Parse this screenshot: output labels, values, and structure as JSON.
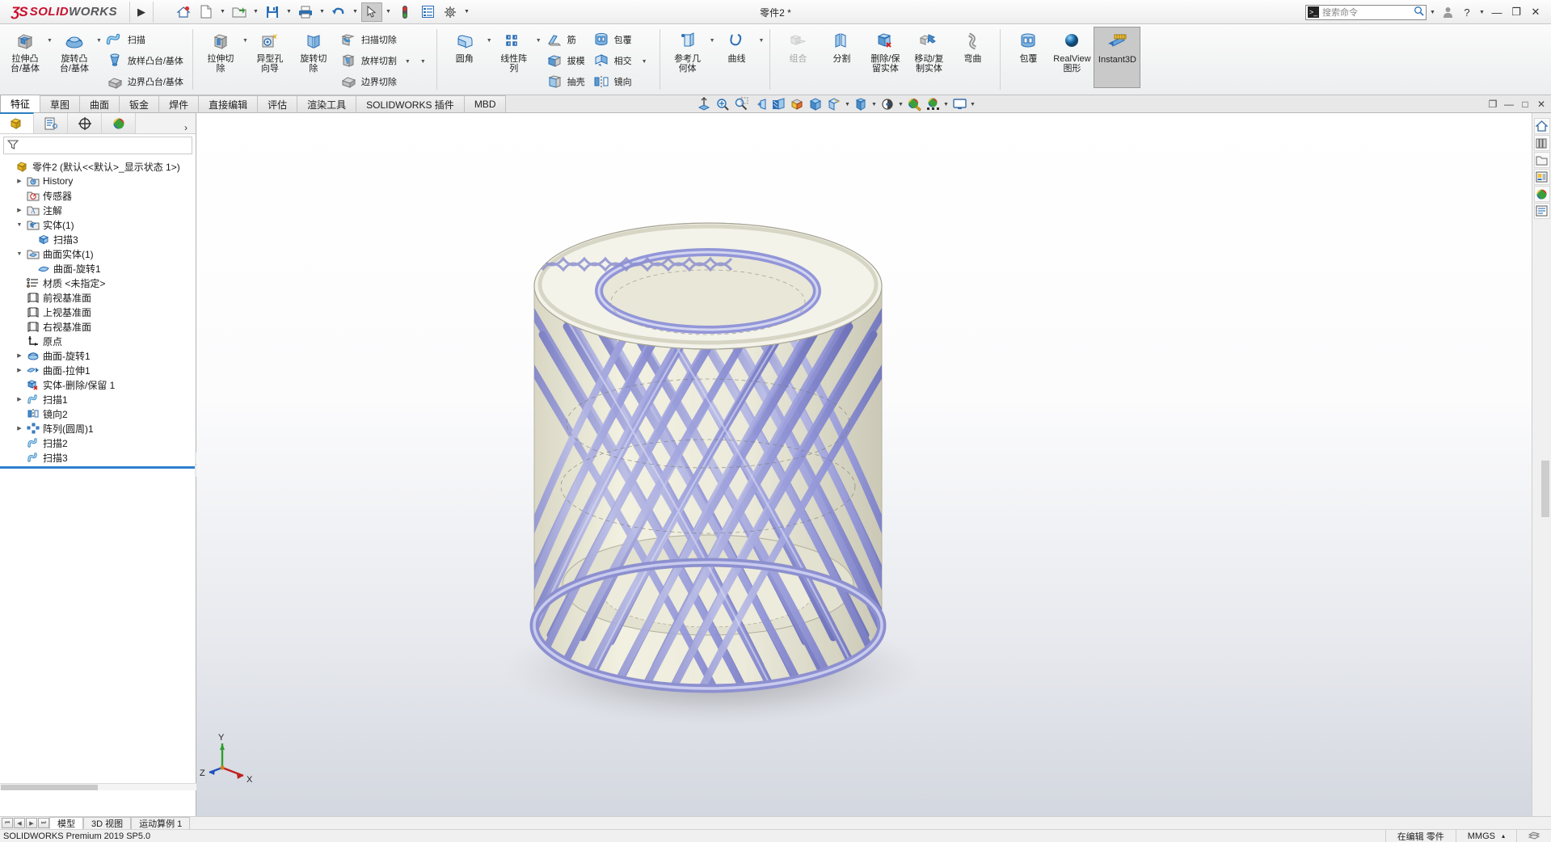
{
  "titlebar": {
    "brand_ds": "ƷS",
    "brand_solid": "SOLID",
    "brand_works": "WORKS",
    "menu_arrow": "▶",
    "doc_title": "零件2 *",
    "quick_icons": [
      {
        "name": "home-icon",
        "glyph": "⌂"
      },
      {
        "name": "new-document-icon",
        "glyph": "὜B"
      },
      {
        "name": "open-folder-icon",
        "glyph": "Ὄ2"
      },
      {
        "name": "save-icon",
        "glyph": "ὋE"
      },
      {
        "name": "print-icon",
        "glyph": "὚8"
      },
      {
        "name": "undo-icon",
        "glyph": "↶"
      },
      {
        "name": "select-cursor-icon",
        "glyph": "➤"
      },
      {
        "name": "rebuild-icon",
        "glyph": "Ὢ6"
      },
      {
        "name": "options-list-icon",
        "glyph": "☰"
      },
      {
        "name": "settings-gear-icon",
        "glyph": "⚙"
      }
    ],
    "search": {
      "placeholder": "搜索命令",
      "value": ""
    },
    "account_icon": "὆4",
    "help_label": "?",
    "minimize": "—",
    "restore": "❐",
    "close": "✕"
  },
  "ribbon": {
    "groups": [
      {
        "name": "features-create",
        "big": [
          {
            "label": "拉伸凸\n台/基体",
            "icon": "extruded-boss-icon",
            "caret": true
          },
          {
            "label": "旋转凸\n台/基体",
            "icon": "revolved-boss-icon",
            "caret": true
          }
        ],
        "small": [
          {
            "label": "扫描",
            "icon": "sweep-icon"
          },
          {
            "label": "放样凸台/基体",
            "icon": "loft-icon"
          },
          {
            "label": "边界凸台/基体",
            "icon": "boundary-boss-icon"
          }
        ]
      },
      {
        "name": "features-cut",
        "big": [
          {
            "label": "拉伸切\n除",
            "icon": "extruded-cut-icon",
            "caret": true
          },
          {
            "label": "异型孔\n向导",
            "icon": "hole-wizard-icon",
            "caret": false
          },
          {
            "label": "旋转切\n除",
            "icon": "revolved-cut-icon",
            "caret": false
          }
        ],
        "small": [
          {
            "label": "扫描切除",
            "icon": "swept-cut-icon"
          },
          {
            "label": "放样切割",
            "icon": "lofted-cut-icon"
          },
          {
            "label": "边界切除",
            "icon": "boundary-cut-icon"
          }
        ]
      },
      {
        "name": "features-modify",
        "big": [
          {
            "label": "圆角",
            "icon": "fillet-icon",
            "caret": true
          },
          {
            "label": "线性阵\n列",
            "icon": "linear-pattern-icon",
            "caret": true
          }
        ],
        "small": [
          {
            "label": "筋",
            "icon": "rib-icon"
          },
          {
            "label": "拔模",
            "icon": "draft-icon"
          },
          {
            "label": "抽壳",
            "icon": "shell-icon"
          }
        ],
        "small2": [
          {
            "label": "包覆",
            "icon": "wrap-icon"
          },
          {
            "label": "相交",
            "icon": "intersect-icon"
          },
          {
            "label": "镜向",
            "icon": "mirror-icon"
          }
        ]
      },
      {
        "name": "reference-geometry",
        "big": [
          {
            "label": "参考几\n何体",
            "icon": "reference-geometry-icon",
            "caret": true
          },
          {
            "label": "曲线",
            "icon": "curves-icon",
            "caret": true
          }
        ]
      },
      {
        "name": "bodies",
        "big": [
          {
            "label": "组合",
            "icon": "combine-icon",
            "disabled": true
          },
          {
            "label": "分割",
            "icon": "split-icon"
          },
          {
            "label": "删除/保\n留实体",
            "icon": "delete-keep-body-icon"
          },
          {
            "label": "移动/复\n制实体",
            "icon": "move-copy-body-icon"
          },
          {
            "label": "弯曲",
            "icon": "flex-icon"
          }
        ]
      },
      {
        "name": "display",
        "big": [
          {
            "label": "包覆",
            "icon": "wrap-icon"
          },
          {
            "label": "RealView\n图形",
            "icon": "realview-icon"
          },
          {
            "label": "Instant3D",
            "icon": "instant3d-icon",
            "selected": true
          }
        ]
      }
    ]
  },
  "command_tabs": [
    {
      "label": "特征",
      "active": true
    },
    {
      "label": "草图",
      "active": false
    },
    {
      "label": "曲面",
      "active": false
    },
    {
      "label": "钣金",
      "active": false
    },
    {
      "label": "焊件",
      "active": false
    },
    {
      "label": "直接编辑",
      "active": false
    },
    {
      "label": "评估",
      "active": false
    },
    {
      "label": "渲染工具",
      "active": false
    },
    {
      "label": "SOLIDWORKS 插件",
      "active": false
    },
    {
      "label": "MBD",
      "active": false
    }
  ],
  "view_toolbar": [
    {
      "name": "zoom-to-fit-icon",
      "glyph": "⤒",
      "caret": false
    },
    {
      "name": "zoom-to-area-icon",
      "glyph": "ὐD",
      "caret": false
    },
    {
      "name": "zoom-window-icon",
      "glyph": "ὐE",
      "caret": false
    },
    {
      "name": "previous-view-icon",
      "glyph": "↩",
      "caret": false
    },
    {
      "name": "section-view-icon",
      "glyph": "◧",
      "caret": false
    },
    {
      "name": "view-orientation-icon",
      "glyph": "◰",
      "caret": false
    },
    {
      "name": "display-style-icon",
      "glyph": "⬛",
      "caret": false
    },
    {
      "name": "hide-show-items-icon",
      "glyph": "◱",
      "caret": true
    },
    {
      "name": "edit-appearance-icon",
      "glyph": "▣",
      "caret": true
    },
    {
      "name": "apply-scene-icon",
      "glyph": "◐",
      "caret": true
    },
    {
      "name": "view-settings-icon",
      "glyph": "◑",
      "caret": false
    },
    {
      "name": "appearances-icon",
      "glyph": "⬤",
      "caret": true
    },
    {
      "name": "display-monitor-icon",
      "glyph": "὚5",
      "caret": true
    }
  ],
  "doc_window_buttons": [
    {
      "name": "restore-doc-icon",
      "glyph": "❐"
    },
    {
      "name": "minimize-doc-icon",
      "glyph": "—"
    },
    {
      "name": "maximize-doc-icon",
      "glyph": "□"
    },
    {
      "name": "close-doc-icon",
      "glyph": "✕"
    }
  ],
  "feature_manager": {
    "tabs": [
      {
        "name": "feature-tree-tab",
        "glyph": "Ἷ5",
        "active": true
      },
      {
        "name": "property-manager-tab",
        "glyph": "Ὅ1",
        "active": false
      },
      {
        "name": "configuration-manager-tab",
        "glyph": "⊕",
        "active": false
      },
      {
        "name": "display-manager-tab",
        "glyph": "◕",
        "active": false
      }
    ],
    "expand_arrow": "›",
    "filter_icon": "filter-icon",
    "root": "零件2  (默认<<默认>_显示状态 1>)",
    "items": [
      {
        "label": "History",
        "indent": 1,
        "arrow": true,
        "icon": "history-icon"
      },
      {
        "label": "传感器",
        "indent": 1,
        "arrow": false,
        "icon": "sensors-icon"
      },
      {
        "label": "注解",
        "indent": 1,
        "arrow": true,
        "icon": "annotations-icon"
      },
      {
        "label": "实体(1)",
        "indent": 1,
        "arrow": true,
        "expanded": true,
        "icon": "solid-bodies-icon"
      },
      {
        "label": "扫描3",
        "indent": 2,
        "arrow": false,
        "icon": "solid-body-icon"
      },
      {
        "label": "曲面实体(1)",
        "indent": 1,
        "arrow": true,
        "expanded": true,
        "icon": "surface-bodies-icon"
      },
      {
        "label": "曲面-旋转1",
        "indent": 2,
        "arrow": false,
        "icon": "surface-body-icon"
      },
      {
        "label": "材质 <未指定>",
        "indent": 1,
        "arrow": false,
        "icon": "material-icon"
      },
      {
        "label": "前视基准面",
        "indent": 1,
        "arrow": false,
        "icon": "plane-icon"
      },
      {
        "label": "上视基准面",
        "indent": 1,
        "arrow": false,
        "icon": "plane-icon"
      },
      {
        "label": "右视基准面",
        "indent": 1,
        "arrow": false,
        "icon": "plane-icon"
      },
      {
        "label": "原点",
        "indent": 1,
        "arrow": false,
        "icon": "origin-icon"
      },
      {
        "label": "曲面-旋转1",
        "indent": 1,
        "arrow": true,
        "icon": "revolve-surface-icon"
      },
      {
        "label": "曲面-拉伸1",
        "indent": 1,
        "arrow": true,
        "icon": "extrude-surface-icon"
      },
      {
        "label": "实体-删除/保留 1",
        "indent": 1,
        "arrow": false,
        "icon": "delete-keep-body-icon"
      },
      {
        "label": "扫描1",
        "indent": 1,
        "arrow": true,
        "icon": "sweep-icon"
      },
      {
        "label": "镜向2",
        "indent": 1,
        "arrow": false,
        "icon": "mirror-icon"
      },
      {
        "label": "阵列(圆周)1",
        "indent": 1,
        "arrow": true,
        "icon": "circular-pattern-icon"
      },
      {
        "label": "扫描2",
        "indent": 1,
        "arrow": false,
        "icon": "sweep-icon"
      },
      {
        "label": "扫描3",
        "indent": 1,
        "arrow": false,
        "icon": "sweep-icon"
      }
    ]
  },
  "right_toolbar": [
    {
      "name": "view-home-icon",
      "glyph": "⌂"
    },
    {
      "name": "appearances-library-icon",
      "glyph": "ὍA"
    },
    {
      "name": "file-explorer-icon",
      "glyph": "Ὄ1"
    },
    {
      "name": "view-palette-icon",
      "glyph": "὜2"
    },
    {
      "name": "appearances-scenes-icon",
      "glyph": "◕"
    },
    {
      "name": "custom-properties-icon",
      "glyph": "☰"
    }
  ],
  "triad": {
    "x": "X",
    "y": "Y",
    "z": "Z"
  },
  "bottom": {
    "nav_buttons": [
      "⏮",
      "◀",
      "▶",
      "⏭"
    ],
    "tabs": [
      {
        "label": "模型",
        "active": true
      },
      {
        "label": "3D 视图",
        "active": false
      },
      {
        "label": "运动算例 1",
        "active": false
      }
    ]
  },
  "status": {
    "left": "SOLIDWORKS Premium 2019 SP5.0",
    "editing": "在编辑 零件",
    "units": "MMGS",
    "units_caret": "▴",
    "overlay_icon": "❖"
  },
  "colors": {
    "brand_red": "#c8102e",
    "accent_blue": "#2f7fd0",
    "model_purple": "#8b8fd4",
    "model_cream": "#eceadb",
    "ribbon_bg": "#eceeef"
  }
}
